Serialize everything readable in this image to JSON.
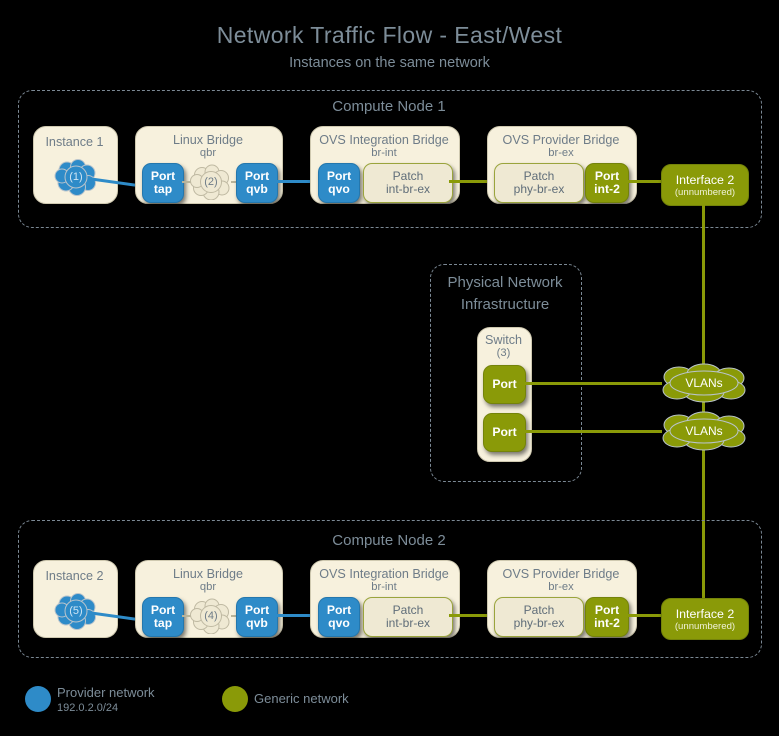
{
  "title": "Network Traffic Flow - East/West",
  "subtitle": "Instances on the same network",
  "colors": {
    "provider_blue": "#2e8bc8",
    "generic_olive": "#8a9a08",
    "panel_cream": "#f7f1dd",
    "background": "#000000",
    "text_slate": "#7d8d99"
  },
  "compute_node_1": {
    "title": "Compute Node 1",
    "instance": {
      "title": "Instance 1",
      "cloud_label": "(1)"
    },
    "linux_bridge": {
      "title": "Linux Bridge",
      "subtitle": "qbr",
      "port_tap": {
        "l1": "Port",
        "l2": "tap"
      },
      "cloud_label": "(2)",
      "port_qvb": {
        "l1": "Port",
        "l2": "qvb"
      }
    },
    "ovs_integration_bridge": {
      "title": "OVS Integration Bridge",
      "subtitle": "br-int",
      "port_qvo": {
        "l1": "Port",
        "l2": "qvo"
      },
      "patch": {
        "l1": "Patch",
        "l2": "int-br-ex"
      }
    },
    "ovs_provider_bridge": {
      "title": "OVS Provider Bridge",
      "subtitle": "br-ex",
      "patch": {
        "l1": "Patch",
        "l2": "phy-br-ex"
      },
      "port_int2": {
        "l1": "Port",
        "l2": "int-2"
      }
    },
    "interface": {
      "l1": "Interface 2",
      "l2": "(unnumbered)"
    }
  },
  "physical_network": {
    "title_line1": "Physical Network",
    "title_line2": "Infrastructure",
    "switch": {
      "title": "Switch",
      "subtitle": "(3)",
      "port_top": "Port",
      "port_bottom": "Port"
    },
    "vlans_top": "VLANs",
    "vlans_bottom": "VLANs"
  },
  "compute_node_2": {
    "title": "Compute Node 2",
    "instance": {
      "title": "Instance 2",
      "cloud_label": "(5)"
    },
    "linux_bridge": {
      "title": "Linux Bridge",
      "subtitle": "qbr",
      "port_tap": {
        "l1": "Port",
        "l2": "tap"
      },
      "cloud_label": "(4)",
      "port_qvb": {
        "l1": "Port",
        "l2": "qvb"
      }
    },
    "ovs_integration_bridge": {
      "title": "OVS Integration Bridge",
      "subtitle": "br-int",
      "port_qvo": {
        "l1": "Port",
        "l2": "qvo"
      },
      "patch": {
        "l1": "Patch",
        "l2": "int-br-ex"
      }
    },
    "ovs_provider_bridge": {
      "title": "OVS Provider Bridge",
      "subtitle": "br-ex",
      "patch": {
        "l1": "Patch",
        "l2": "phy-br-ex"
      },
      "port_int2": {
        "l1": "Port",
        "l2": "int-2"
      }
    },
    "interface": {
      "l1": "Interface 2",
      "l2": "(unnumbered)"
    }
  },
  "legend": {
    "provider": {
      "label": "Provider network",
      "subnet": "192.0.2.0/24"
    },
    "generic": {
      "label": "Generic network"
    }
  }
}
